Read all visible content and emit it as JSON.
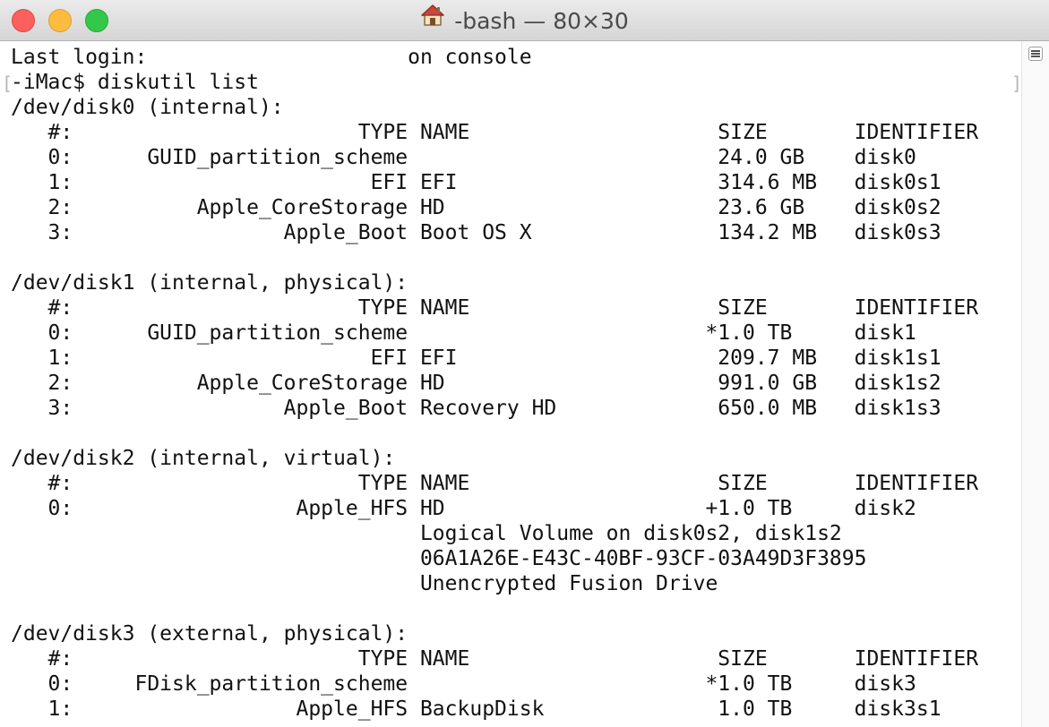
{
  "window": {
    "title": "-bash — 80×30",
    "title_icon": "home-icon"
  },
  "terminal": {
    "lines": [
      "Last login:                     on console",
      "-iMac$ diskutil list",
      "/dev/disk0 (internal):",
      "   #:                       TYPE NAME                    SIZE       IDENTIFIER",
      "   0:      GUID_partition_scheme                         24.0 GB    disk0",
      "   1:                        EFI EFI                     314.6 MB   disk0s1",
      "   2:          Apple_CoreStorage HD                      23.6 GB    disk0s2",
      "   3:                 Apple_Boot Boot OS X               134.2 MB   disk0s3",
      "",
      "/dev/disk1 (internal, physical):",
      "   #:                       TYPE NAME                    SIZE       IDENTIFIER",
      "   0:      GUID_partition_scheme                        *1.0 TB     disk1",
      "   1:                        EFI EFI                     209.7 MB   disk1s1",
      "   2:          Apple_CoreStorage HD                      991.0 GB   disk1s2",
      "   3:                 Apple_Boot Recovery HD             650.0 MB   disk1s3",
      "",
      "/dev/disk2 (internal, virtual):",
      "   #:                       TYPE NAME                    SIZE       IDENTIFIER",
      "   0:                  Apple_HFS HD                     +1.0 TB     disk2",
      "                                 Logical Volume on disk0s2, disk1s2",
      "                                 06A1A26E-E43C-40BF-93CF-03A49D3F3895",
      "                                 Unencrypted Fusion Drive",
      "",
      "/dev/disk3 (external, physical):",
      "   #:                       TYPE NAME                    SIZE       IDENTIFIER",
      "   0:     FDisk_partition_scheme                        *1.0 TB     disk3",
      "   1:                  Apple_HFS BackupDisk              1.0 TB     disk3s1"
    ]
  },
  "colors": {
    "close": "#fc605c",
    "minimize": "#fdbc40",
    "zoom": "#34c84a",
    "text": "#111111"
  }
}
